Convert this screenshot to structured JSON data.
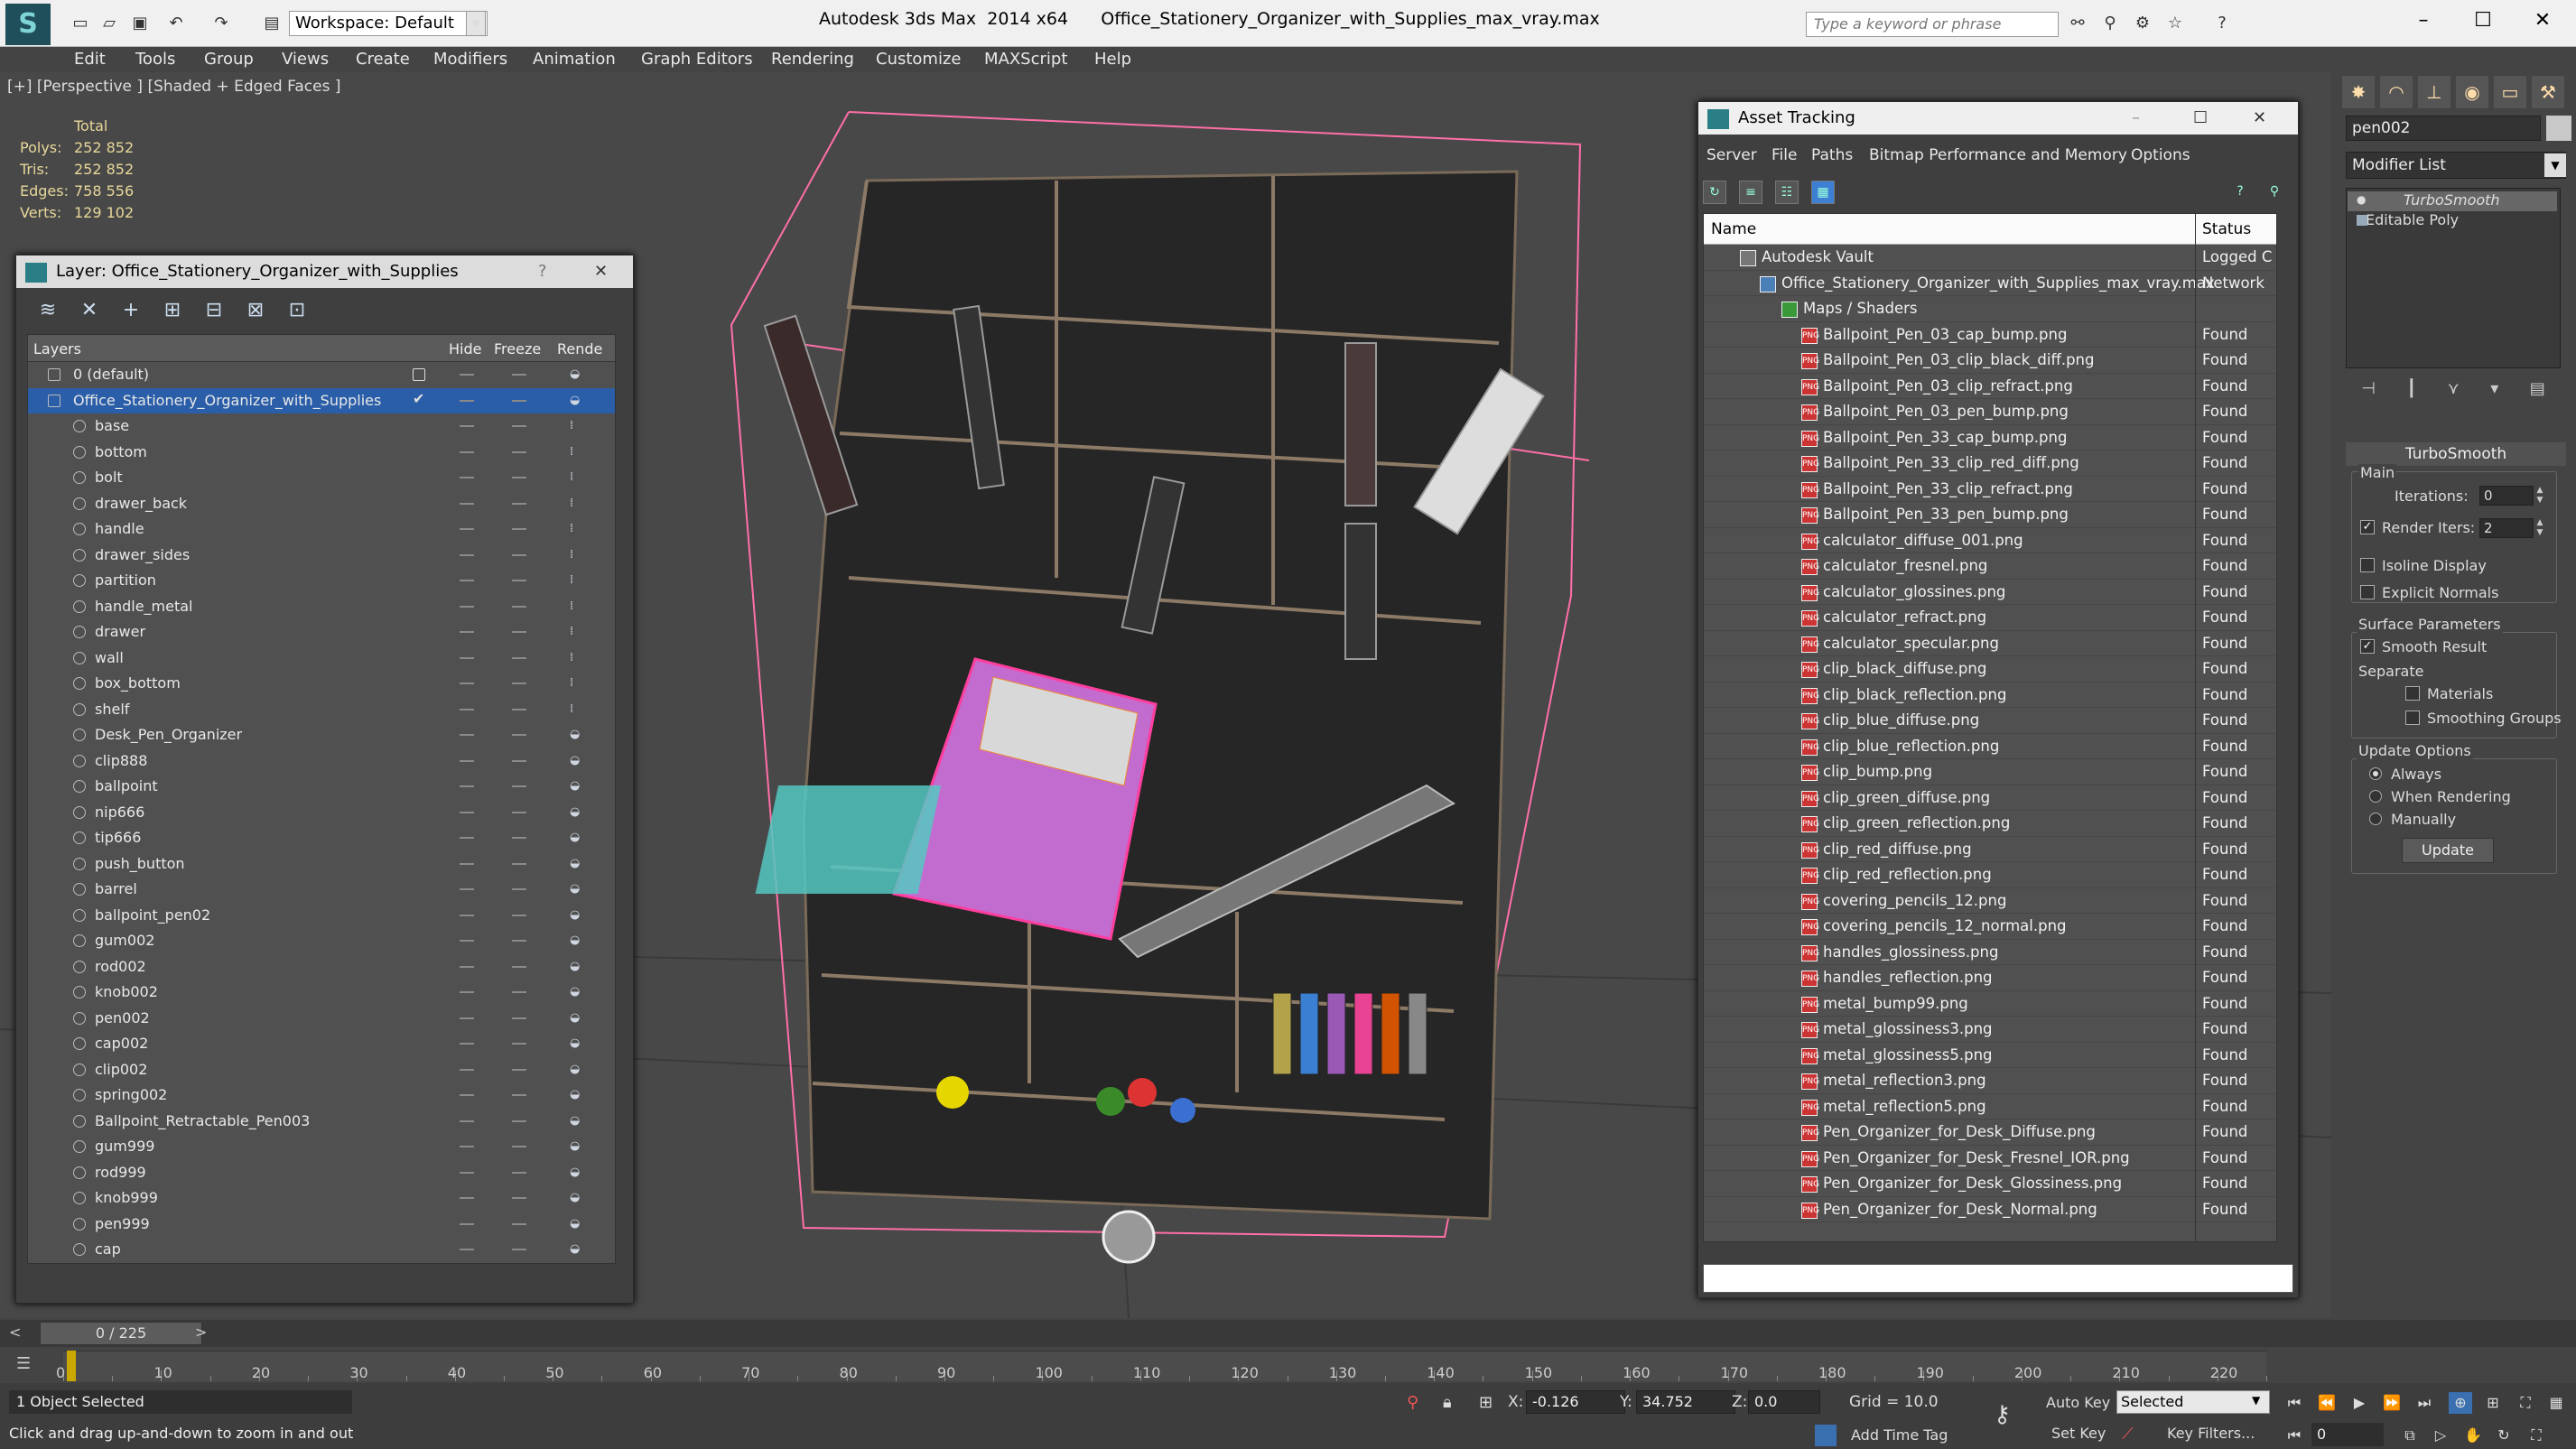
{
  "titlebar": {
    "workspace": "Workspace: Default",
    "title": "Autodesk 3ds Max  2014 x64      Office_Stationery_Organizer_with_Supplies_max_vray.max",
    "search_placeholder": "Type a keyword or phrase"
  },
  "menu": [
    "Edit",
    "Tools",
    "Group",
    "Views",
    "Create",
    "Modifiers",
    "Animation",
    "Graph Editors",
    "Rendering",
    "Customize",
    "MAXScript",
    "Help"
  ],
  "viewport": {
    "label": "[+] [Perspective ] [Shaded + Edged Faces ]",
    "stats": {
      "total_label": "Total",
      "rows": [
        {
          "k": "Polys:",
          "v": "252 852"
        },
        {
          "k": "Tris:",
          "v": "252 852"
        },
        {
          "k": "Edges:",
          "v": "758 556"
        },
        {
          "k": "Verts:",
          "v": "129 102"
        }
      ]
    }
  },
  "layer_panel": {
    "title": "Layer: Office_Stationery_Organizer_with_Supplies",
    "help": "?",
    "close": "✕",
    "columns": {
      "layers": "Layers",
      "hide": "Hide",
      "freeze": "Freeze",
      "render": "Rende"
    },
    "default_layer": "0 (default)",
    "active_layer": "Office_Stationery_Organizer_with_Supplies",
    "objects": [
      "base",
      "bottom",
      "bolt",
      "drawer_back",
      "handle",
      "drawer_sides",
      "partition",
      "handle_metal",
      "drawer",
      "wall",
      "box_bottom",
      "shelf",
      "Desk_Pen_Organizer",
      "clip888",
      "ballpoint",
      "nip666",
      "tip666",
      "push_button",
      "barrel",
      "ballpoint_pen02",
      "gum002",
      "rod002",
      "knob002",
      "pen002",
      "cap002",
      "clip002",
      "spring002",
      "Ballpoint_Retractable_Pen003",
      "gum999",
      "rod999",
      "knob999",
      "pen999",
      "cap"
    ]
  },
  "asset_panel": {
    "title": "Asset Tracking",
    "menu": [
      "Server",
      "File",
      "Paths",
      "Bitmap Performance and Memory",
      "Options"
    ],
    "columns": {
      "name": "Name",
      "status": "Status"
    },
    "vault": {
      "name": "Autodesk Vault",
      "status": "Logged C"
    },
    "file": {
      "name": "Office_Stationery_Organizer_with_Supplies_max_vray.max",
      "status": "Network"
    },
    "maps_group": "Maps / Shaders",
    "maps": [
      {
        "name": "Ballpoint_Pen_03_cap_bump.png",
        "status": "Found"
      },
      {
        "name": "Ballpoint_Pen_03_clip_black_diff.png",
        "status": "Found"
      },
      {
        "name": "Ballpoint_Pen_03_clip_refract.png",
        "status": "Found"
      },
      {
        "name": "Ballpoint_Pen_03_pen_bump.png",
        "status": "Found"
      },
      {
        "name": "Ballpoint_Pen_33_cap_bump.png",
        "status": "Found"
      },
      {
        "name": "Ballpoint_Pen_33_clip_red_diff.png",
        "status": "Found"
      },
      {
        "name": "Ballpoint_Pen_33_clip_refract.png",
        "status": "Found"
      },
      {
        "name": "Ballpoint_Pen_33_pen_bump.png",
        "status": "Found"
      },
      {
        "name": "calculator_diffuse_001.png",
        "status": "Found"
      },
      {
        "name": "calculator_fresnel.png",
        "status": "Found"
      },
      {
        "name": "calculator_glossines.png",
        "status": "Found"
      },
      {
        "name": "calculator_refract.png",
        "status": "Found"
      },
      {
        "name": "calculator_specular.png",
        "status": "Found"
      },
      {
        "name": "clip_black_diffuse.png",
        "status": "Found"
      },
      {
        "name": "clip_black_reflection.png",
        "status": "Found"
      },
      {
        "name": "clip_blue_diffuse.png",
        "status": "Found"
      },
      {
        "name": "clip_blue_reflection.png",
        "status": "Found"
      },
      {
        "name": "clip_bump.png",
        "status": "Found"
      },
      {
        "name": "clip_green_diffuse.png",
        "status": "Found"
      },
      {
        "name": "clip_green_reflection.png",
        "status": "Found"
      },
      {
        "name": "clip_red_diffuse.png",
        "status": "Found"
      },
      {
        "name": "clip_red_reflection.png",
        "status": "Found"
      },
      {
        "name": "covering_pencils_12.png",
        "status": "Found"
      },
      {
        "name": "covering_pencils_12_normal.png",
        "status": "Found"
      },
      {
        "name": "handles_glossiness.png",
        "status": "Found"
      },
      {
        "name": "handles_reflection.png",
        "status": "Found"
      },
      {
        "name": "metal_bump99.png",
        "status": "Found"
      },
      {
        "name": "metal_glossiness3.png",
        "status": "Found"
      },
      {
        "name": "metal_glossiness5.png",
        "status": "Found"
      },
      {
        "name": "metal_reflection3.png",
        "status": "Found"
      },
      {
        "name": "metal_reflection5.png",
        "status": "Found"
      },
      {
        "name": "Pen_Organizer_for_Desk_Diffuse.png",
        "status": "Found"
      },
      {
        "name": "Pen_Organizer_for_Desk_Fresnel_IOR.png",
        "status": "Found"
      },
      {
        "name": "Pen_Organizer_for_Desk_Glossiness.png",
        "status": "Found"
      },
      {
        "name": "Pen_Organizer_for_Desk_Normal.png",
        "status": "Found"
      }
    ]
  },
  "command_panel": {
    "object_name": "pen002",
    "modifier_list": "Modifier List",
    "stack": [
      "TurboSmooth",
      "Editable Poly"
    ],
    "turbosmooth": {
      "title": "TurboSmooth",
      "main": "Main",
      "iterations_label": "Iterations:",
      "iterations": "0",
      "render_iters_label": "Render Iters:",
      "render_iters": "2",
      "isoline": "Isoline Display",
      "explicit_normals": "Explicit Normals",
      "surface_params": "Surface Parameters",
      "smooth_result": "Smooth Result",
      "separate": "Separate",
      "materials": "Materials",
      "smoothing_groups": "Smoothing Groups",
      "update_options": "Update Options",
      "always": "Always",
      "when_rendering": "When Rendering",
      "manually": "Manually",
      "update_button": "Update"
    }
  },
  "timeline": {
    "slider": "0 / 225",
    "ticks": [
      "0",
      "10",
      "20",
      "30",
      "40",
      "50",
      "60",
      "70",
      "80",
      "90",
      "100",
      "110",
      "120",
      "130",
      "140",
      "150",
      "160",
      "170",
      "180",
      "190",
      "200",
      "210",
      "220"
    ]
  },
  "statusbar": {
    "selection": "1 Object Selected",
    "prompt": "Click and drag up-and-down to zoom in and out",
    "x_label": "X:",
    "x": "-0.126",
    "y_label": "Y:",
    "y": "34.752",
    "z_label": "Z:",
    "z": "0.0",
    "grid": "Grid = 10.0",
    "add_time_tag": "Add Time Tag",
    "auto_key": "Auto Key",
    "set_key": "Set Key",
    "selected": "Selected",
    "key_filters": "Key Filters...",
    "frame": "0"
  }
}
